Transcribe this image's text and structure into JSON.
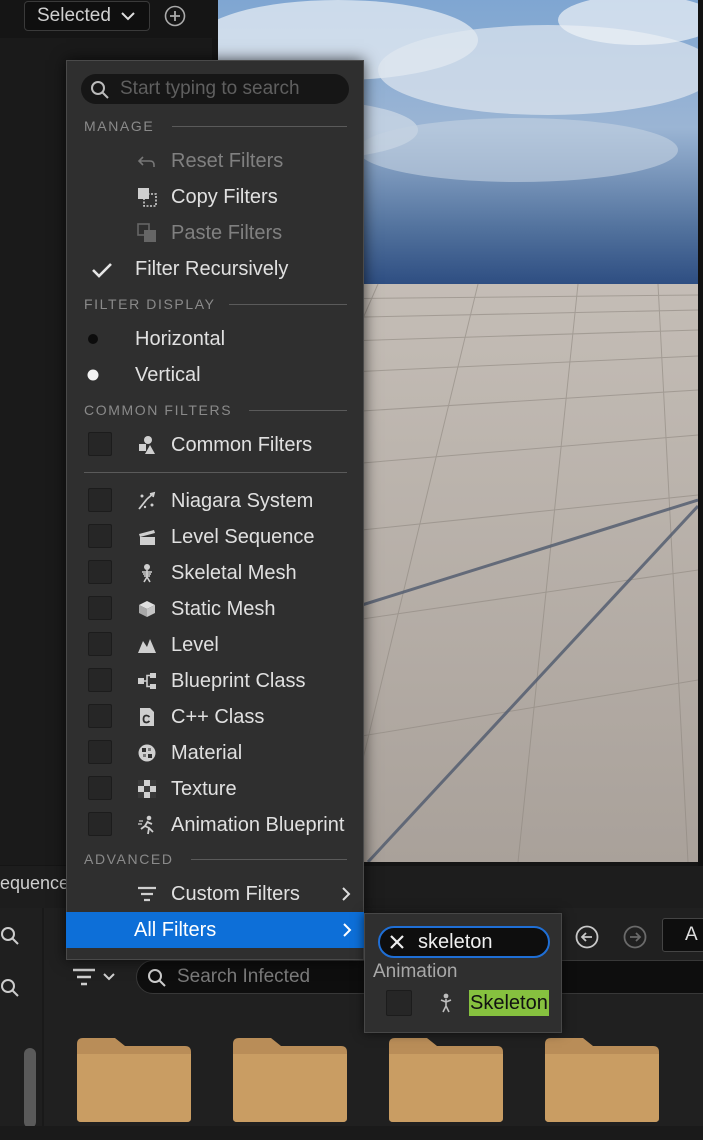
{
  "outliner": {
    "selected_label": "Selected"
  },
  "menu": {
    "search_placeholder": "Start typing to search",
    "sections": {
      "manage": "MANAGE",
      "filter_display": "FILTER DISPLAY",
      "common_filters": "COMMON FILTERS",
      "advanced": "ADVANCED"
    },
    "manage_items": {
      "reset": "Reset Filters",
      "copy": "Copy Filters",
      "paste": "Paste Filters",
      "recursive": "Filter Recursively"
    },
    "display_items": {
      "horizontal": "Horizontal",
      "vertical": "Vertical"
    },
    "common_item": "Common Filters",
    "filters": [
      "Niagara System",
      "Level Sequence",
      "Skeletal Mesh",
      "Static Mesh",
      "Level",
      "Blueprint Class",
      "C++ Class",
      "Material",
      "Texture",
      "Animation Blueprint"
    ],
    "advanced_items": {
      "custom": "Custom Filters",
      "all": "All Filters"
    }
  },
  "submenu": {
    "search_value": "skeleton",
    "category": "Animation",
    "item": "Skeleton"
  },
  "content_browser": {
    "tab_fragment": "equence",
    "search_placeholder": "Search Infected",
    "path_fragment": "A"
  },
  "colors": {
    "highlight": "#0d6fd8",
    "match_highlight": "#86c13f",
    "accent_focus": "#1f6fd6"
  }
}
